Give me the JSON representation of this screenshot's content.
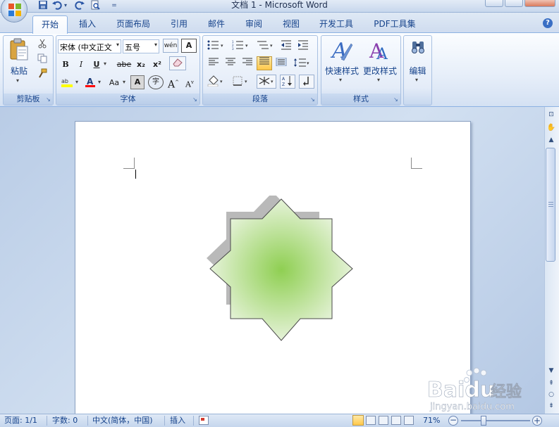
{
  "window": {
    "title": "文档 1 - Microsoft Word"
  },
  "quick_access": {
    "save_icon": "save-icon",
    "undo_icon": "undo-icon",
    "redo_icon": "redo-icon",
    "print_preview_icon": "print-preview-icon",
    "customize_icon": "chevron-down-icon"
  },
  "tabs": [
    {
      "label": "开始",
      "active": true
    },
    {
      "label": "插入"
    },
    {
      "label": "页面布局"
    },
    {
      "label": "引用"
    },
    {
      "label": "邮件"
    },
    {
      "label": "审阅"
    },
    {
      "label": "视图"
    },
    {
      "label": "开发工具"
    },
    {
      "label": "PDF工具集"
    }
  ],
  "ribbon": {
    "clipboard": {
      "label": "剪贴板",
      "paste_label": "粘贴"
    },
    "font": {
      "label": "字体",
      "font_name": "宋体 (中文正文",
      "font_size": "五号",
      "bold": "B",
      "italic": "I",
      "underline": "U",
      "strikethrough": "abe",
      "subscript": "x₂",
      "superscript": "x²",
      "change_case": "Aa",
      "grow_font": "A",
      "shrink_font": "A",
      "phonetic": "wén",
      "char_border": "A",
      "char_shading": "A",
      "enclose": "字"
    },
    "paragraph": {
      "label": "段落"
    },
    "styles": {
      "label": "样式",
      "quick_styles": "快速样式",
      "change_styles": "更改样式"
    },
    "editing": {
      "label": "编辑"
    }
  },
  "statusbar": {
    "page": "页面: 1/1",
    "words": "字数: 0",
    "language": "中文(简体，中国)",
    "mode": "插入",
    "zoom": "71%"
  },
  "colors": {
    "highlight": "#ffff00",
    "font_color": "#ff0000",
    "star_center": "#8fcf52",
    "star_edge": "#eef6e6"
  },
  "watermark": {
    "brand": "Baidu",
    "brand_cn": "经验",
    "url": "jingyan.baidu.com"
  }
}
